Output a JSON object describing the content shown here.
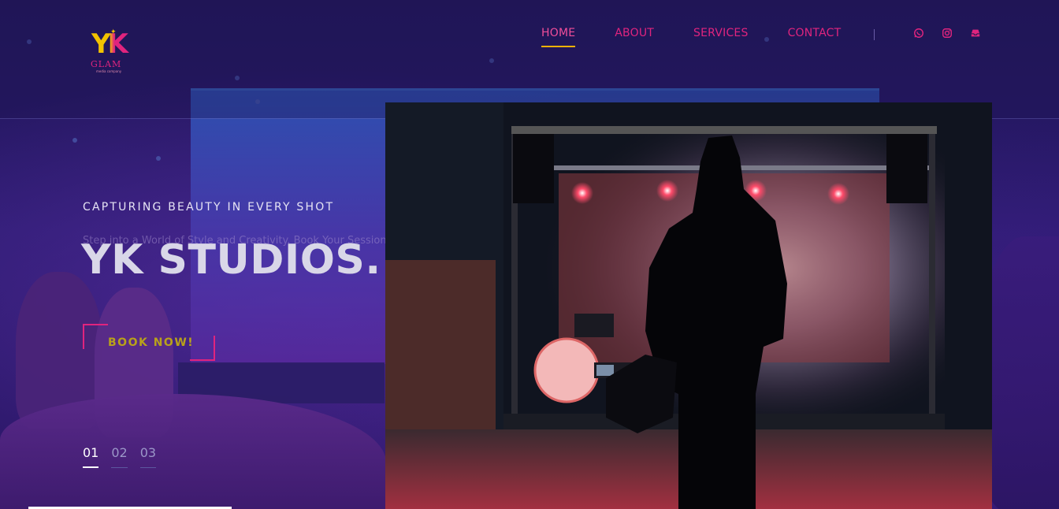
{
  "brand": {
    "logo_text": "YK",
    "logo_sub": "GLAM",
    "logo_tagline": "media company"
  },
  "nav": {
    "items": [
      {
        "label": "HOME",
        "active": true
      },
      {
        "label": "ABOUT",
        "active": false
      },
      {
        "label": "SERVICES",
        "active": false
      },
      {
        "label": "CONTACT",
        "active": false
      }
    ]
  },
  "social": {
    "icons": [
      "whatsapp-icon",
      "instagram-icon",
      "inbox-icon"
    ]
  },
  "hero": {
    "tagline": "CAPTURING BEAUTY IN EVERY SHOT",
    "subtitle": "Step into a World of Style and Creativity. Book Your Session Today!",
    "title": "YK STUDIOS.",
    "cta_label": "BOOK NOW!"
  },
  "slides": {
    "items": [
      "01",
      "02",
      "03"
    ],
    "active_index": 0
  },
  "colors": {
    "accent_pink": "#e0247e",
    "accent_gold": "#f2b100",
    "background": "#1b1450"
  }
}
